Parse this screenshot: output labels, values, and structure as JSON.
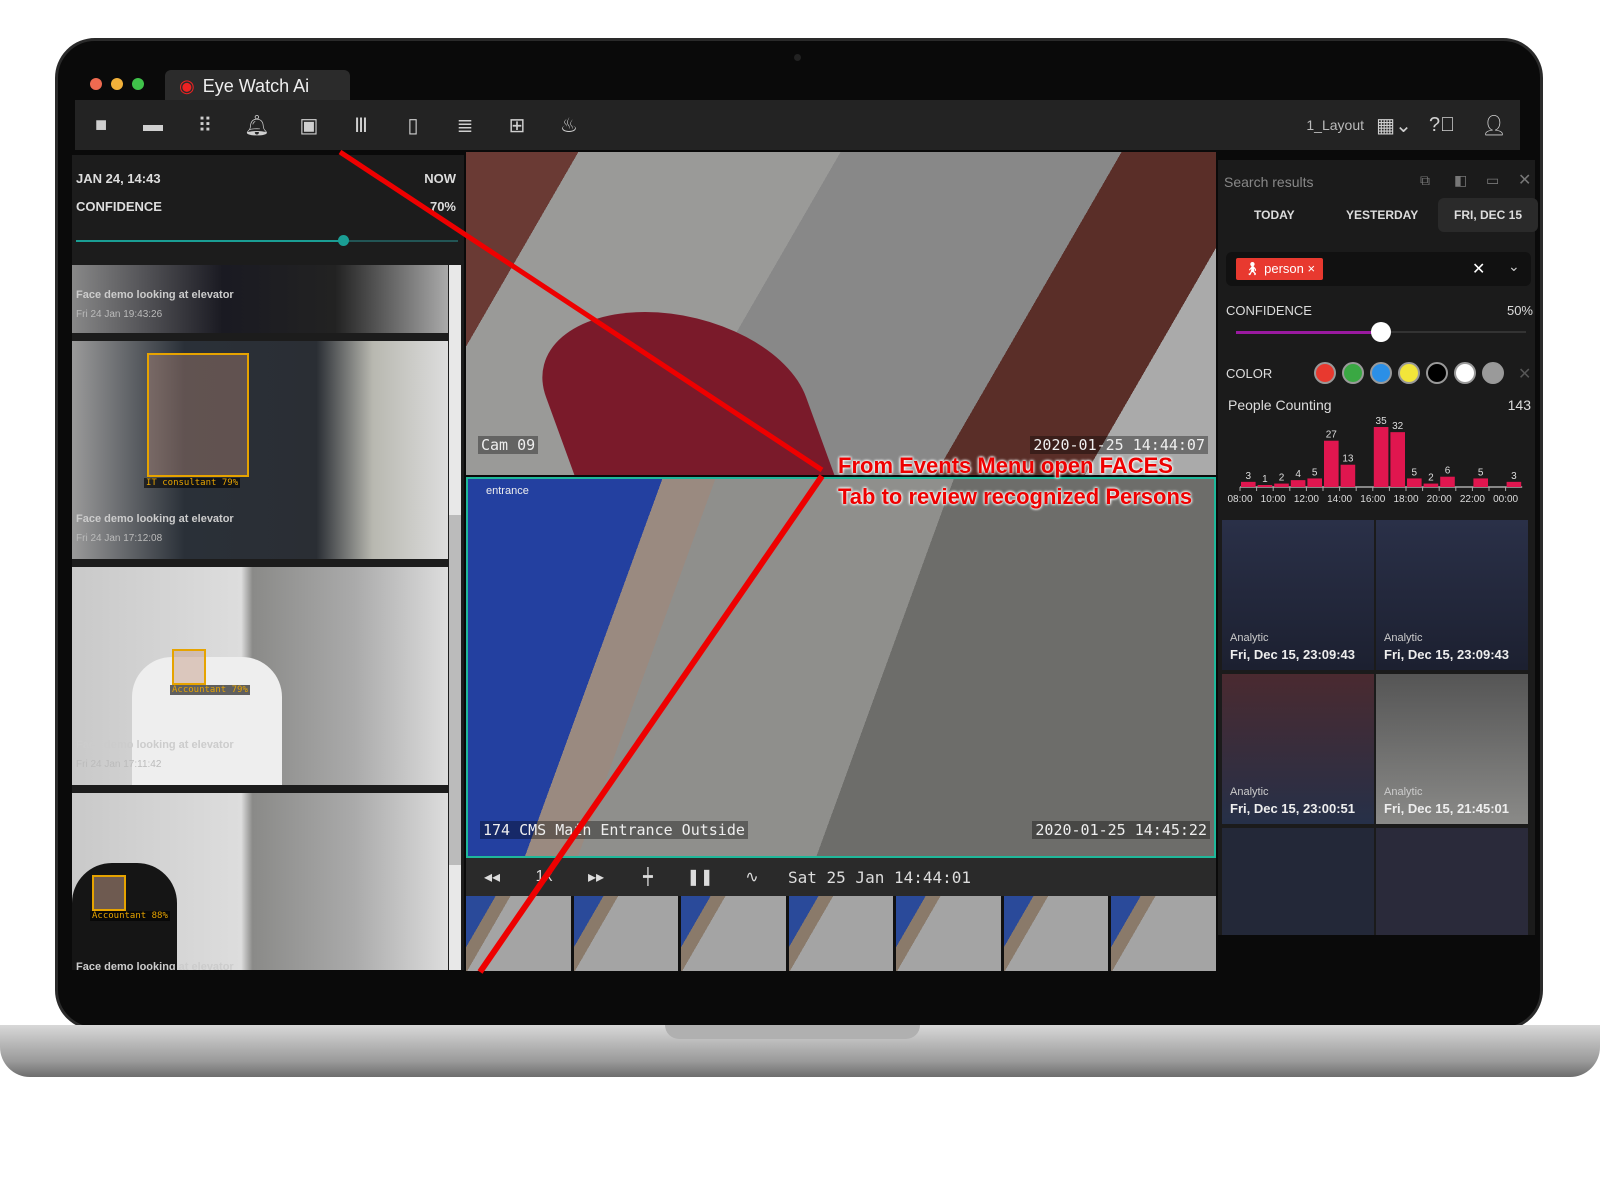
{
  "app": {
    "title": "Eye Watch Ai",
    "layout": "1_Layout"
  },
  "toolbar": {
    "icons": [
      "camera-icon",
      "folder-icon",
      "grid-icon",
      "bell-icon",
      "calendar-icon",
      "library-icon",
      "map-icon",
      "list-icon",
      "tiles-icon",
      "fire-icon"
    ]
  },
  "left_panel": {
    "date_from": "JAN 24, 14:43",
    "date_to": "NOW",
    "confidence_label": "CONFIDENCE",
    "confidence_value": "70%",
    "confidence": 70,
    "events": [
      {
        "title": "Face demo looking at elevator",
        "time": "Fri 24 Jan 19:43:26"
      },
      {
        "title": "Face demo looking at elevator",
        "time": "Fri 24 Jan 17:12:08",
        "tag": "IT consultant 79%"
      },
      {
        "title": "Face demo looking at elevator",
        "time": "Fri 24 Jan 17:11:42",
        "tag": "Accountant 79%"
      },
      {
        "title": "Face demo looking at elevator",
        "time": "",
        "tag": "Accountant 88%"
      }
    ]
  },
  "cameras": [
    {
      "name": "Cam 09",
      "timestamp": "2020-01-25 14:44:07"
    },
    {
      "name": "174 CMS Main Entrance Outside",
      "label": "entrance",
      "timestamp": "2020-01-25 14:45:22"
    }
  ],
  "playback": {
    "speed": "1x",
    "datetime": "Sat 25 Jan 14:44:01"
  },
  "annotation": {
    "line1": "From Events Menu open FACES",
    "line2": "Tab to review recognized Persons"
  },
  "right_panel": {
    "title": "Search results",
    "date_tabs": [
      "TODAY",
      "YESTERDAY",
      "FRI, DEC 15"
    ],
    "active_tab": "FRI, DEC 15",
    "filter_chip": "person",
    "confidence_label": "CONFIDENCE",
    "confidence_value": "50%",
    "confidence": 50,
    "color_label": "COLOR",
    "colors": [
      "#e8392f",
      "#3aa843",
      "#2b8fe6",
      "#f2e53a",
      "#000000",
      "#ffffff",
      "#9a9a9a"
    ],
    "chart_accent": "#e0164f",
    "results": [
      {
        "type": "Analytic",
        "time": "Fri, Dec 15, 23:09:43"
      },
      {
        "type": "Analytic",
        "time": "Fri, Dec 15, 23:09:43"
      },
      {
        "type": "Analytic",
        "time": "Fri, Dec 15, 23:00:51"
      },
      {
        "type": "Analytic",
        "time": "Fri, Dec 15, 21:45:01"
      }
    ]
  },
  "chart_data": {
    "type": "bar",
    "title": "People Counting",
    "total": "143",
    "x": [
      "08:00",
      "09:00",
      "10:00",
      "11:00",
      "12:00",
      "13:00",
      "14:00",
      "15:00",
      "16:00",
      "17:00",
      "18:00",
      "19:00",
      "20:00",
      "21:00",
      "22:00",
      "23:00",
      "00:00"
    ],
    "values": [
      3,
      1,
      2,
      4,
      5,
      27,
      13,
      0,
      35,
      32,
      5,
      2,
      6,
      0,
      5,
      0,
      3
    ],
    "tick_labels": [
      "08:00",
      "10:00",
      "12:00",
      "14:00",
      "16:00",
      "18:00",
      "20:00",
      "22:00",
      "00:00"
    ],
    "ylim": [
      0,
      35
    ]
  }
}
